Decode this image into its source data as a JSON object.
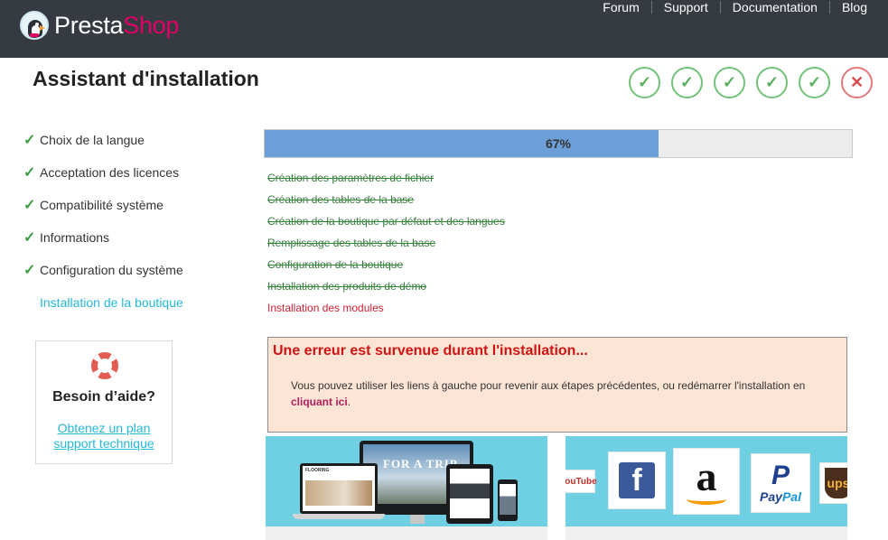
{
  "header": {
    "logo": {
      "part1": "Presta",
      "part2": "Shop"
    },
    "nav": [
      "Forum",
      "Support",
      "Documentation",
      "Blog"
    ]
  },
  "page": {
    "title": "Assistant d'installation"
  },
  "progress_steps": {
    "symbols": [
      "✓",
      "✓",
      "✓",
      "✓",
      "✓",
      "✕"
    ],
    "status": [
      "done",
      "done",
      "done",
      "done",
      "done",
      "error"
    ]
  },
  "sidebar": {
    "check_symbol": "✓",
    "items": [
      {
        "label": "Choix de la langue",
        "status": "done"
      },
      {
        "label": "Acceptation des licences",
        "status": "done"
      },
      {
        "label": "Compatibilité système",
        "status": "done"
      },
      {
        "label": "Informations",
        "status": "done"
      },
      {
        "label": "Configuration du système",
        "status": "done"
      },
      {
        "label": "Installation de la boutique",
        "status": "current"
      }
    ]
  },
  "help": {
    "title": "Besoin d’aide?",
    "link": "Obtenez un plan support technique"
  },
  "progress": {
    "percent": 67,
    "label": "67%"
  },
  "tasks": [
    {
      "label": "Création des paramètres de fichier",
      "state": "done"
    },
    {
      "label": "Création des tables de la base",
      "state": "done"
    },
    {
      "label": "Création de la boutique par défaut et des langues",
      "state": "done"
    },
    {
      "label": "Remplissage des tables de la base",
      "state": "done"
    },
    {
      "label": "Configuration de la boutique",
      "state": "done"
    },
    {
      "label": "Installation des produits de démo",
      "state": "done"
    },
    {
      "label": "Installation des modules",
      "state": "active"
    }
  ],
  "error": {
    "title": "Une erreur est survenue durant l'installation...",
    "message": "Vous pouvez utiliser les liens à gauche pour revenir aux étapes précédentes, ou redémarrer l'installation en ",
    "link": "cliquant ici",
    "suffix": "."
  },
  "banners": {
    "devices_screen_text": "FOR A TRIP",
    "youtube": "YouTube",
    "facebook": "f",
    "amazon": "a",
    "paypal_p": "P",
    "paypal_pay": "Pay",
    "paypal_pal": "Pal",
    "ups": "ups"
  },
  "colors": {
    "topbar": "#363a41",
    "brand_pink": "#df0067",
    "link_blue": "#25b9d7",
    "progress_fill": "#6c9ed8",
    "error_red": "#d01414",
    "success_green": "#3c9d44"
  }
}
